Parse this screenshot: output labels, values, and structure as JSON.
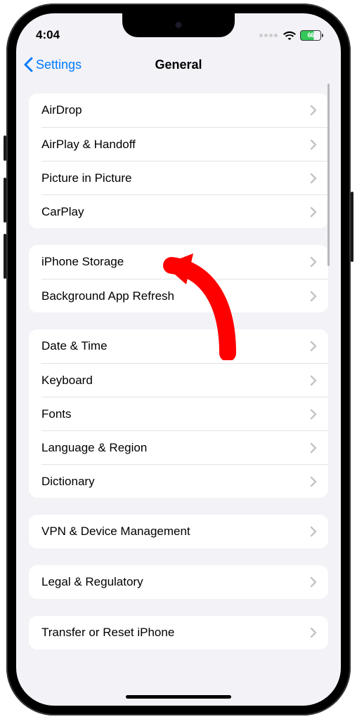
{
  "status": {
    "time": "4:04",
    "battery": "66"
  },
  "nav": {
    "back": "Settings",
    "title": "General"
  },
  "groups": [
    {
      "rows": [
        {
          "label": "AirDrop",
          "name": "airdrop"
        },
        {
          "label": "AirPlay & Handoff",
          "name": "airplay-handoff"
        },
        {
          "label": "Picture in Picture",
          "name": "picture-in-picture"
        },
        {
          "label": "CarPlay",
          "name": "carplay"
        }
      ]
    },
    {
      "rows": [
        {
          "label": "iPhone Storage",
          "name": "iphone-storage"
        },
        {
          "label": "Background App Refresh",
          "name": "background-app-refresh"
        }
      ]
    },
    {
      "rows": [
        {
          "label": "Date & Time",
          "name": "date-time"
        },
        {
          "label": "Keyboard",
          "name": "keyboard"
        },
        {
          "label": "Fonts",
          "name": "fonts"
        },
        {
          "label": "Language & Region",
          "name": "language-region"
        },
        {
          "label": "Dictionary",
          "name": "dictionary"
        }
      ]
    },
    {
      "rows": [
        {
          "label": "VPN & Device Management",
          "name": "vpn-device-management"
        }
      ]
    },
    {
      "rows": [
        {
          "label": "Legal & Regulatory",
          "name": "legal-regulatory"
        }
      ]
    },
    {
      "rows": [
        {
          "label": "Transfer or Reset iPhone",
          "name": "transfer-reset-iphone"
        }
      ]
    }
  ],
  "annotation": {
    "arrow_color": "#ff0000",
    "target": "iphone-storage"
  }
}
